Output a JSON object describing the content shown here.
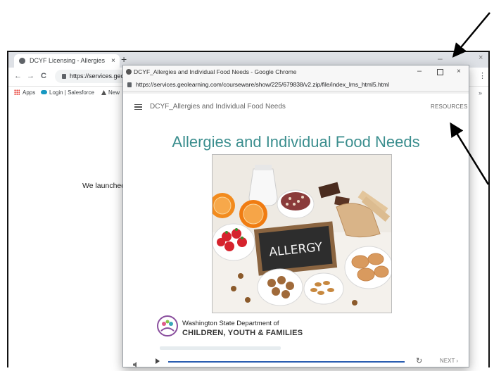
{
  "background_browser": {
    "tab_title": "DCYF Licensing - Allergies and In",
    "tab_close": "×",
    "new_tab": "+",
    "window_minimize": "–",
    "window_close": "×",
    "nav_back": "←",
    "nav_forward": "→",
    "nav_reload": "C",
    "url": "https://services.geol",
    "menu": "⋮",
    "bookmarks": [
      "Apps",
      "Login | Salesforce",
      "New"
    ],
    "bookmarks_chevron": "»",
    "page_text": "We launched"
  },
  "popup": {
    "window_title": "DCYF_Allergies and Individual Food Needs - Google Chrome",
    "minimize": "–",
    "close": "×",
    "url": "https://services.geolearning.com/courseware/show/225/679838/v2.zip/file/index_lms_html5.html",
    "course_name": "DCYF_Allergies and Individual Food Needs",
    "resources_label": "RESOURCES",
    "slide_title": "Allergies and Individual Food Needs",
    "chalkboard_text": "ALLERGY",
    "org_line1": "Washington State Department of",
    "org_line2": "CHILDREN, YOUTH & FAMILIES",
    "replay_icon": "↻",
    "next_label": "NEXT ›"
  },
  "colors": {
    "title_teal": "#3b8e8e",
    "seek_blue": "#2a5db0"
  }
}
